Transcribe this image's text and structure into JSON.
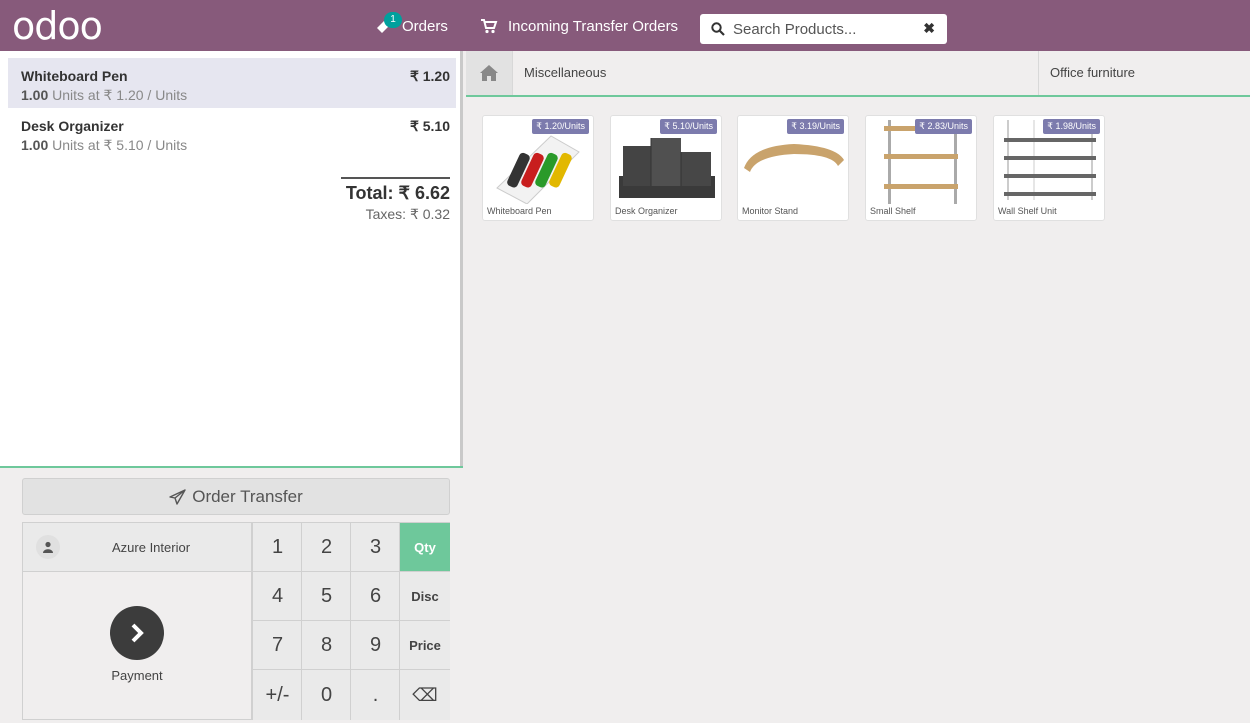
{
  "header": {
    "logo": "odoo",
    "orders_label": "Orders",
    "orders_badge": "1",
    "incoming_label": "Incoming Transfer Orders",
    "search_placeholder": "Search Products...",
    "clear_symbol": "✖"
  },
  "orderlines": [
    {
      "name": "Whiteboard Pen",
      "price": "₹ 1.20",
      "qty": "1.00",
      "info": " Units at ₹ 1.20 / Units"
    },
    {
      "name": "Desk Organizer",
      "price": "₹ 5.10",
      "qty": "1.00",
      "info": " Units at ₹ 5.10 / Units"
    }
  ],
  "summary": {
    "total": "Total: ₹ 6.62",
    "taxes": "Taxes: ₹ 0.32"
  },
  "controls": {
    "transfer_label": "Order Transfer",
    "customer": "Azure Interior",
    "payment_label": "Payment",
    "keys": [
      "1",
      "2",
      "3",
      "Qty",
      "4",
      "5",
      "6",
      "Disc",
      "7",
      "8",
      "9",
      "Price",
      "+/-",
      "0",
      "."
    ],
    "backspace_symbol": "⌫",
    "active_mode": "Qty"
  },
  "categories": {
    "first": "Miscellaneous",
    "second": "Office furniture"
  },
  "products": [
    {
      "name": "Whiteboard Pen",
      "price": "₹ 1.20/Units",
      "icon": "whiteboard-pen-image"
    },
    {
      "name": "Desk Organizer",
      "price": "₹ 5.10/Units",
      "icon": "desk-organizer-image"
    },
    {
      "name": "Monitor Stand",
      "price": "₹ 3.19/Units",
      "icon": "monitor-stand-image"
    },
    {
      "name": "Small Shelf",
      "price": "₹ 2.83/Units",
      "icon": "small-shelf-image"
    },
    {
      "name": "Wall Shelf Unit",
      "price": "₹ 1.98/Units",
      "icon": "wall-shelf-image"
    }
  ],
  "colors": {
    "header": "#875a7b",
    "accent": "#6ec89b",
    "badge": "#00a09d",
    "price_tag": "#7c7bad",
    "selected_line": "#e6e6f0"
  }
}
